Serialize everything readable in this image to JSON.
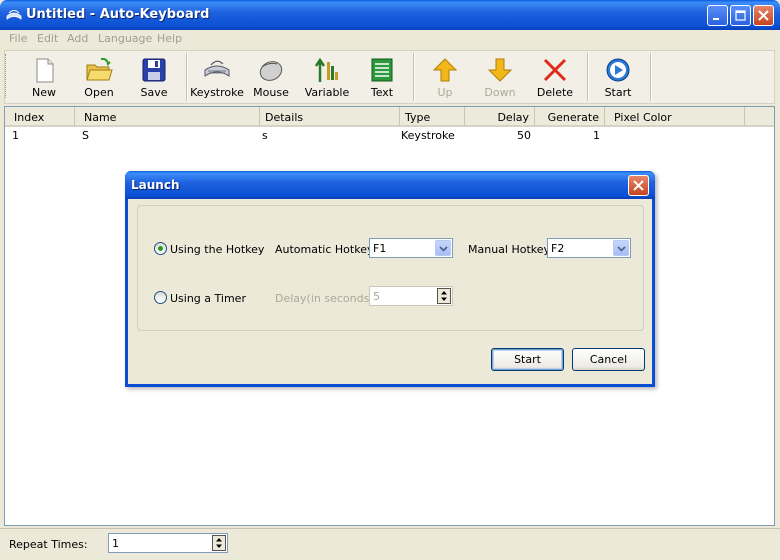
{
  "window": {
    "title": "Untitled - Auto-Keyboard"
  },
  "menu": [
    "File",
    "Edit",
    "Add",
    "Language",
    "Help"
  ],
  "toolbar": {
    "new": "New",
    "open": "Open",
    "save": "Save",
    "keystroke": "Keystroke",
    "mouse": "Mouse",
    "variable": "Variable",
    "text": "Text",
    "up": "Up",
    "down": "Down",
    "delete": "Delete",
    "start": "Start"
  },
  "table": {
    "columns": [
      "Index",
      "Name",
      "Details",
      "Type",
      "Delay",
      "Generate",
      "Pixel Color"
    ],
    "rows": [
      {
        "index": "1",
        "name": "S",
        "details": "s",
        "type": "Keystroke",
        "delay": "50",
        "generate": "1",
        "pixel_color": ""
      }
    ]
  },
  "dialog": {
    "title": "Launch",
    "using_hotkey_label": "Using the Hotkey",
    "using_timer_label": "Using a Timer",
    "automatic_hotkey_label": "Automatic Hotkey:",
    "automatic_hotkey_value": "F1",
    "manual_hotkey_label": "Manual Hotkey:",
    "manual_hotkey_value": "F2",
    "delay_label": "Delay(in seconds):",
    "delay_value": "5",
    "start_label": "Start",
    "cancel_label": "Cancel",
    "selected_mode": "hotkey"
  },
  "status": {
    "repeat_label": "Repeat Times:",
    "repeat_value": "1"
  },
  "colors": {
    "titlebar": "#0b4fd4",
    "face": "#ece9d8",
    "disabled_text": "#aca899"
  }
}
